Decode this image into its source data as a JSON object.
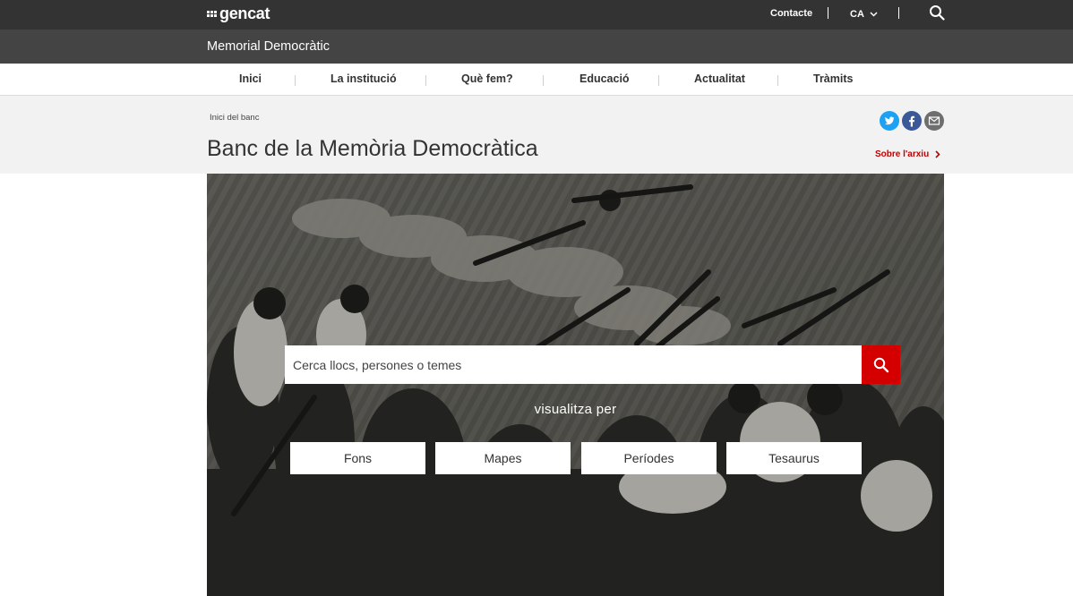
{
  "topbar": {
    "logo_text": "gencat",
    "contact_label": "Contacte",
    "language": "CA"
  },
  "site": {
    "title": "Memorial Democràtic"
  },
  "nav": {
    "items": [
      {
        "label": "Inici"
      },
      {
        "label": "La institució"
      },
      {
        "label": "Què fem?"
      },
      {
        "label": "Educació"
      },
      {
        "label": "Actualitat"
      },
      {
        "label": "Tràmits"
      }
    ]
  },
  "header": {
    "breadcrumb": "Inici del banc",
    "title": "Banc de la Memòria Democràtica",
    "about_link": "Sobre l'arxiu",
    "share": [
      "twitter-icon",
      "facebook-icon",
      "email-icon"
    ]
  },
  "hero": {
    "search_placeholder": "Cerca llocs, persones o temes",
    "view_by_label": "visualitza per",
    "view_buttons": [
      {
        "label": "Fons"
      },
      {
        "label": "Mapes"
      },
      {
        "label": "Períodes"
      },
      {
        "label": "Tesaurus"
      }
    ]
  },
  "colors": {
    "topbar": "#333333",
    "sitebar": "#444444",
    "accent_red": "#d40000",
    "twitter": "#1da1f2",
    "facebook": "#3b5998",
    "email": "#6e6e6e"
  }
}
